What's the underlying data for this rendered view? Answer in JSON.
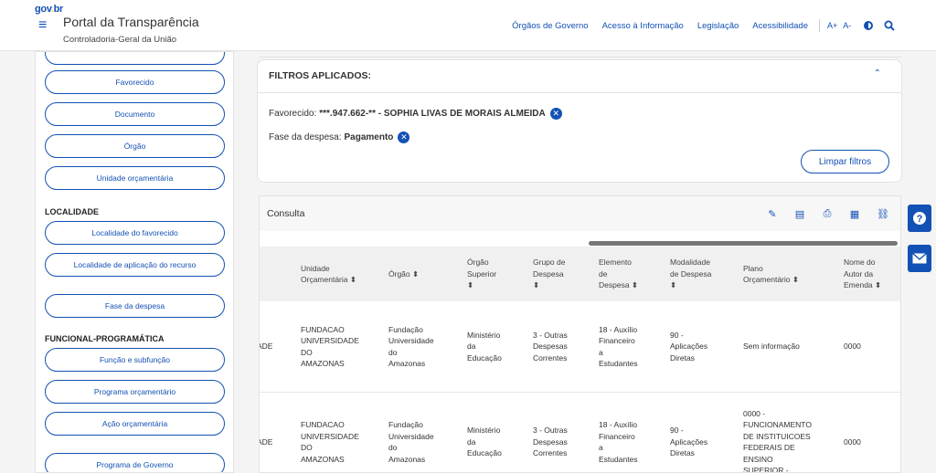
{
  "header": {
    "brand": [
      "gov",
      ".",
      "br"
    ],
    "title": "Portal da Transparência",
    "subtitle": "Controladoria-Geral da União",
    "nav": [
      "Órgãos de Governo",
      "Acesso à Informação",
      "Legislação",
      "Acessibilidade"
    ],
    "font_up": "A+",
    "font_down": "A-"
  },
  "sidebar": {
    "buttons_top": [
      "Favorecido",
      "Documento",
      "Órgão",
      "Unidade orçamentária"
    ],
    "section_localidade": "LOCALIDADE",
    "buttons_localidade": [
      "Localidade do favorecido",
      "Localidade de aplicação do recurso"
    ],
    "fase": "Fase da despesa",
    "section_funcional": "FUNCIONAL-PROGRAMÁTICA",
    "buttons_funcional": [
      "Função e subfunção",
      "Programa orçamentário",
      "Ação orçamentária"
    ],
    "programa_governo": "Programa de Governo"
  },
  "filters": {
    "title": "FILTROS APLICADOS:",
    "favorecido_label": "Favorecido:",
    "favorecido_value": "***.947.662-** - SOPHIA LIVAS DE MORAIS ALMEIDA",
    "fase_label": "Fase da despesa:",
    "fase_value": "Pagamento",
    "clear_label": "Limpar filtros"
  },
  "consulta": {
    "title": "Consulta",
    "columns": [
      [
        "Unidade",
        "Orçamentária ⬍"
      ],
      [
        "Órgão ⬍"
      ],
      [
        "Órgão",
        "Superior",
        "⬍"
      ],
      [
        "Grupo de",
        "Despesa",
        "⬍"
      ],
      [
        "Elemento",
        "de",
        "Despesa ⬍"
      ],
      [
        "Modalidade",
        "de Despesa",
        "⬍"
      ],
      [
        "Plano",
        "Orçamentário ⬍"
      ],
      [
        "Nome do",
        "Autor da",
        "Emenda ⬍"
      ]
    ],
    "rows": [
      {
        "cut": "ADE",
        "cells": [
          [
            "FUNDACAO",
            "UNIVERSIDADE",
            "DO",
            "AMAZONAS"
          ],
          [
            "Fundação",
            "Universidade",
            "do",
            "Amazonas"
          ],
          [
            "Ministério",
            "da",
            "Educação"
          ],
          [
            "3 - Outras",
            "Despesas",
            "Correntes"
          ],
          [
            "18 - Auxílio",
            "Financeiro",
            "a",
            "Estudantes"
          ],
          [
            "90 -",
            "Aplicações",
            "Diretas"
          ],
          [
            "Sem informação"
          ],
          [
            "0000"
          ]
        ]
      },
      {
        "cut": "ADE",
        "cells": [
          [
            "FUNDACAO",
            "UNIVERSIDADE",
            "DO",
            "AMAZONAS"
          ],
          [
            "Fundação",
            "Universidade",
            "do",
            "Amazonas"
          ],
          [
            "Ministério",
            "da",
            "Educação"
          ],
          [
            "3 - Outras",
            "Despesas",
            "Correntes"
          ],
          [
            "18 - Auxílio",
            "Financeiro",
            "a",
            "Estudantes"
          ],
          [
            "90 -",
            "Aplicações",
            "Diretas"
          ],
          [
            "0000 -",
            "FUNCIONAMENTO",
            "DE INSTITUICOES",
            "FEDERAIS DE",
            "ENSINO",
            "SUPERIOR -"
          ],
          [
            "0000"
          ]
        ]
      }
    ]
  },
  "colors": {
    "primary": "#1351b4",
    "gov_yellow": "#ffcd07"
  }
}
